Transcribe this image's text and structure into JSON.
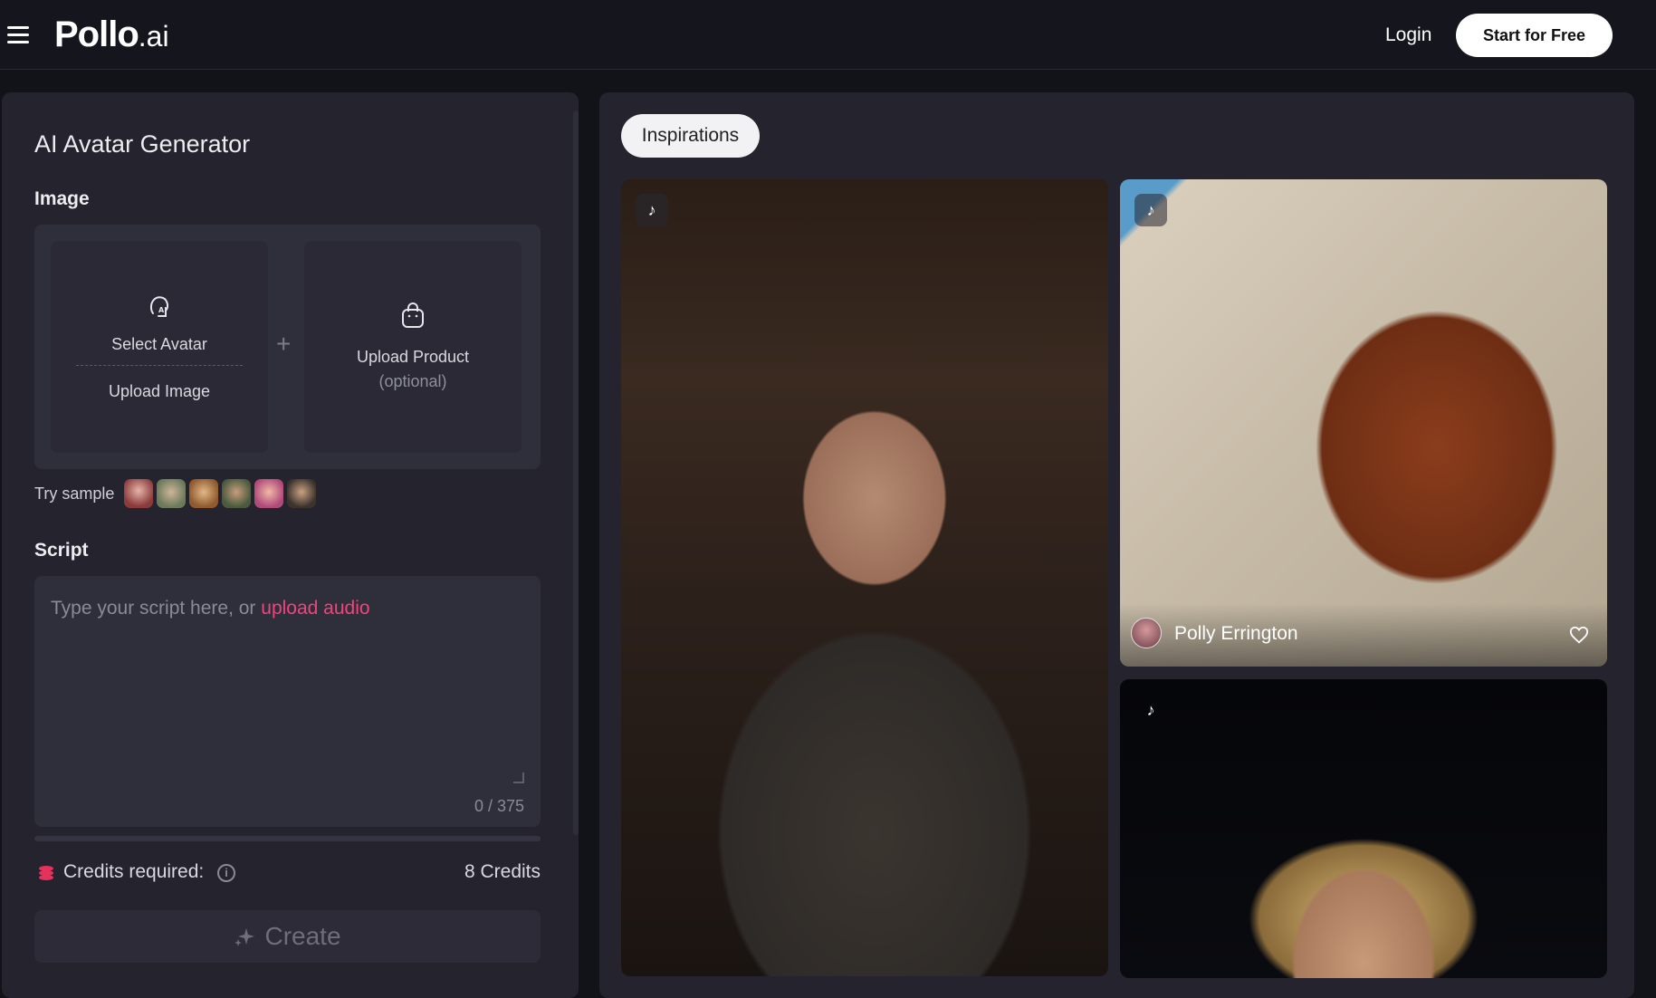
{
  "header": {
    "logo_main": "Pollo",
    "logo_suffix": ".ai",
    "login_label": "Login",
    "start_label": "Start for Free"
  },
  "generator": {
    "title": "AI Avatar Generator",
    "image_label": "Image",
    "select_avatar": "Select Avatar",
    "upload_image": "Upload Image",
    "plus": "+",
    "upload_product": "Upload Product",
    "optional": "(optional)",
    "try_sample": "Try sample",
    "samples": [
      "sample-1",
      "sample-2",
      "sample-3",
      "sample-4",
      "sample-5",
      "sample-6"
    ],
    "script_label": "Script",
    "script_value": "",
    "script_placeholder_prefix": "Type your script here, or ",
    "script_upload_audio": "upload audio",
    "counter": "0 / 375",
    "credits_label": "Credits required:",
    "credits_value": "8 Credits",
    "create_label": "Create"
  },
  "inspirations": {
    "tab_label": "Inspirations",
    "items": [
      {
        "type": "video",
        "creator": ""
      },
      {
        "type": "video",
        "creator": "Polly Errington"
      },
      {
        "type": "video",
        "creator": ""
      }
    ]
  },
  "colors": {
    "background": "#121219",
    "panel": "#24232e",
    "accent_pink": "#f0457c",
    "credits_icon": "#e5325d"
  }
}
